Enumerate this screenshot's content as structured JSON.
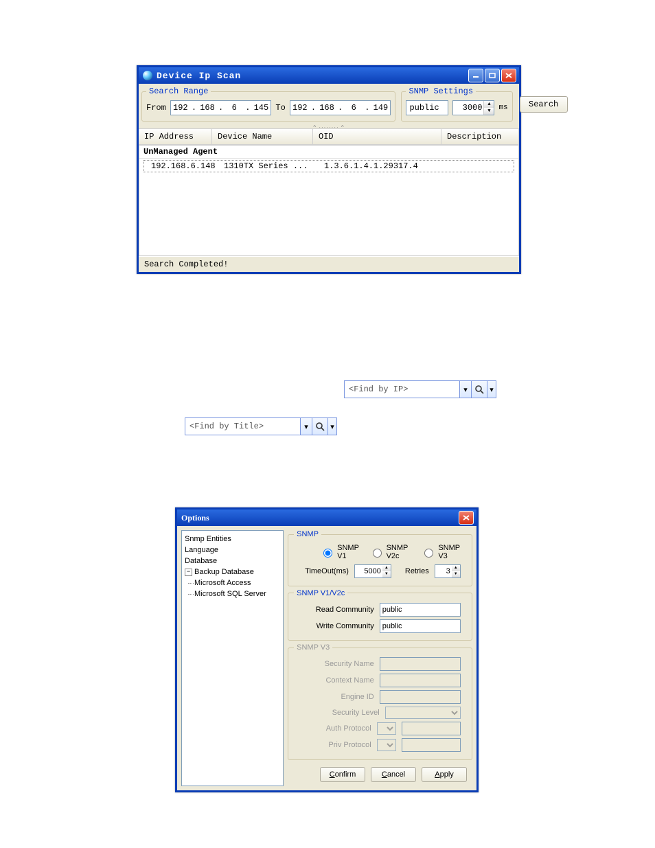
{
  "scan_window": {
    "title": "Device Ip Scan",
    "search_range": {
      "legend": "Search Range",
      "from_label": "From",
      "to_label": "To",
      "from_ip": [
        "192",
        "168",
        "6",
        "145"
      ],
      "to_ip": [
        "192",
        "168",
        "6",
        "149"
      ]
    },
    "snmp_settings": {
      "legend": "SNMP Settings",
      "community": "public",
      "timeout": "3000",
      "unit": "ms"
    },
    "search_button": "Search",
    "columns": {
      "ip": "IP Address",
      "device": "Device Name",
      "oid": "OID",
      "desc": "Description"
    },
    "group_label": "UnManaged Agent",
    "rows": [
      {
        "ip": "192.168.6.148",
        "device": "1310TX Series ...",
        "oid": "1.3.6.1.4.1.29317.4",
        "desc": ""
      }
    ],
    "status": "Search Completed!"
  },
  "find_ip_placeholder": "<Find by IP>",
  "find_title_placeholder": "<Find by Title>",
  "options_dialog": {
    "title": "Options",
    "tree": {
      "snmp_entities": "Snmp Entities",
      "language": "Language",
      "database": "Database",
      "backup": "Backup Database",
      "access": "Microsoft Access",
      "sql": "Microsoft SQL Server"
    },
    "snmp": {
      "legend": "SNMP",
      "v1": "SNMP V1",
      "v2c": "SNMP V2c",
      "v3": "SNMP V3",
      "timeout_label": "TimeOut(ms)",
      "timeout": "5000",
      "retries_label": "Retries",
      "retries": "3"
    },
    "v1v2c": {
      "legend": "SNMP V1/V2c",
      "read_label": "Read Community",
      "read": "public",
      "write_label": "Write Community",
      "write": "public"
    },
    "v3": {
      "legend": "SNMP V3",
      "sec_name": "Security Name",
      "ctx_name": "Context Name",
      "engine": "Engine ID",
      "sec_level": "Security Level",
      "auth": "Auth Protocol",
      "priv": "Priv Protocol"
    },
    "buttons": {
      "confirm": "Confirm",
      "cancel": "Cancel",
      "apply": "Apply"
    }
  }
}
